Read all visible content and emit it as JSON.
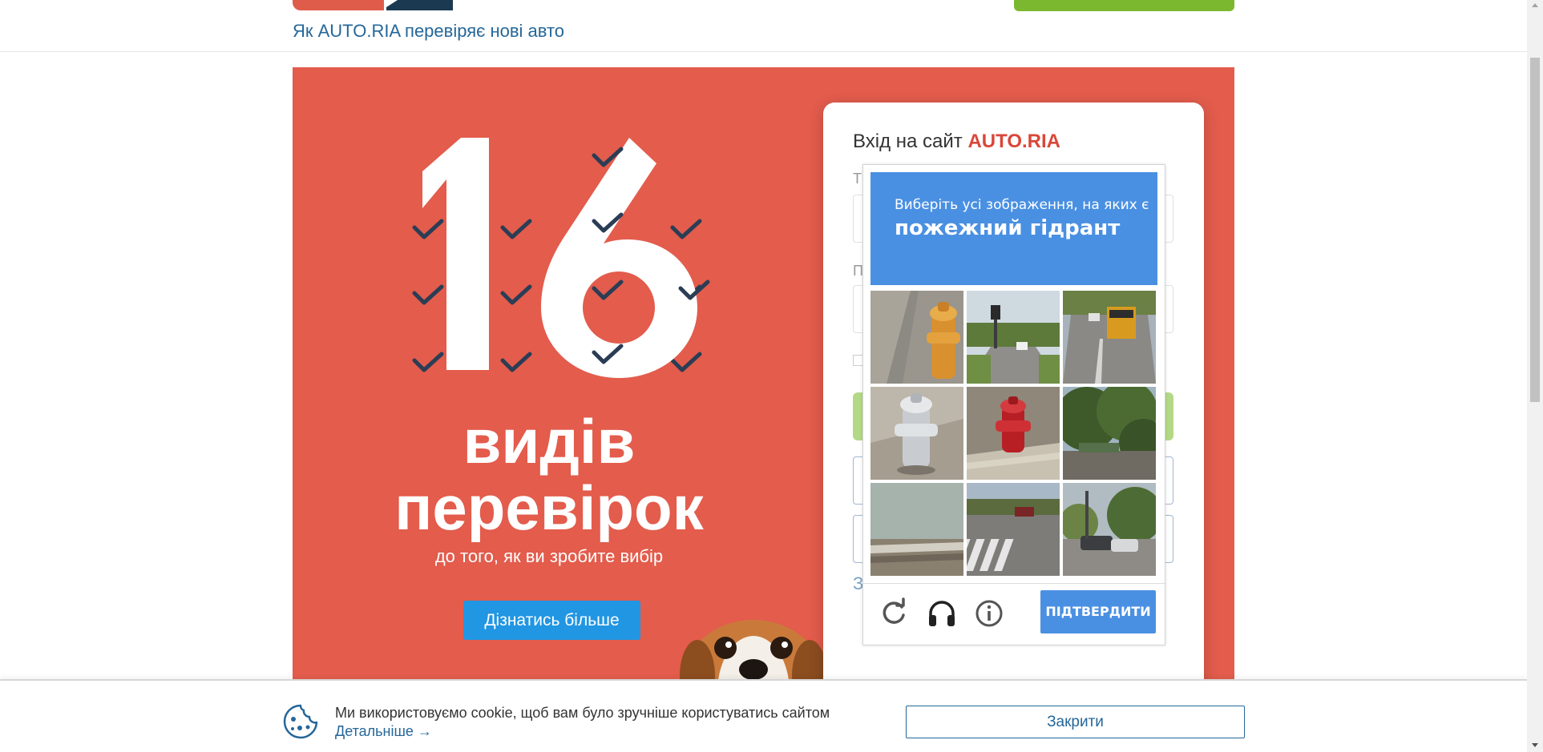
{
  "header": {
    "check_link": "Як AUTO.RIA перевіряє нові авто"
  },
  "banner": {
    "number": "16",
    "line1": "видів",
    "line2": "перевірок",
    "line3": "до того, як ви зробите вибір",
    "cta": "Дізнатись більше"
  },
  "login": {
    "title_prefix": "Вхід на сайт ",
    "title_brand": "AUTO.RIA",
    "ghost_label_1": "Т",
    "ghost_label_2": "П",
    "ghost_link": "З"
  },
  "captcha": {
    "instruction": "Виберіть усі зображення, на яких є",
    "target": "пожежний гідрант",
    "tiles": [
      {
        "name": "hydrant-yellow-sidewalk"
      },
      {
        "name": "road-traffic-light"
      },
      {
        "name": "road-school-bus"
      },
      {
        "name": "hydrant-silver-sidewalk"
      },
      {
        "name": "hydrant-red-curb"
      },
      {
        "name": "trees-street"
      },
      {
        "name": "bridge-river"
      },
      {
        "name": "crosswalk-intersection"
      },
      {
        "name": "street-cars-trees"
      }
    ],
    "icons": [
      "refresh-icon",
      "headphones-icon",
      "info-icon"
    ],
    "verify": "ПІДТВЕРДИТИ",
    "accent": "#4a90e2"
  },
  "cookie": {
    "text": "Ми використовуємо cookie, щоб вам було зручніше користуватись сайтом",
    "link": "Детальніше →",
    "close": "Закрити"
  },
  "colors": {
    "banner": "#e35c4c",
    "brand_red": "#d9473a",
    "link_blue": "#256799",
    "cta_blue": "#2196e3",
    "green": "#7cb82f",
    "check_dark": "#2b3d55"
  }
}
